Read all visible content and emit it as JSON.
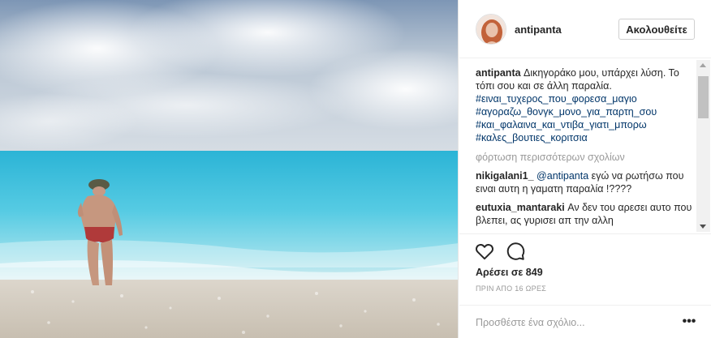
{
  "post": {
    "username": "antipanta",
    "follow_label": "Ακολουθείτε",
    "caption": {
      "username": "antipanta",
      "text": "Δικηγοράκο μου, υπάρχει λύση. Το τόπι σου και σε άλλη παραλία.",
      "hashtags": [
        "#ειναι_τυχερος_που_φορεσα_μαγιο",
        "#αγοραζω_θονγκ_μονο_για_παρτη_σου",
        "#και_φαλαινα_και_ντιβα_γιατι_μπορω",
        "#καλες_βουτιες_κοριτσια"
      ]
    },
    "load_more_label": "φόρτωση περισσότερων σχολίων",
    "comments": [
      {
        "username": "nikigalani1_",
        "mention": "@antipanta",
        "text": "εγώ να ρωτήσω που ειναι αυτη η γαματη παραλία !????"
      },
      {
        "username": "eutuxia_mantaraki",
        "mention": "",
        "text": "Αν δεν του αρεσει αυτο που βλεπει, ας γυρισει απ την αλλη"
      }
    ],
    "likes_label": "Αρέσει σε 849",
    "time_label": "ΠΡΙΝ ΑΠΟ 16 ΩΡΕΣ",
    "comment_placeholder": "Προσθέστε ένα σχόλιο...",
    "more_label": "•••"
  },
  "icons": {
    "like": "heart-icon",
    "comment": "speech-bubble-icon",
    "more": "ellipsis-icon"
  },
  "colors": {
    "link": "#003569",
    "muted": "#999999",
    "sea": "#4fc3dc",
    "sky": "#c9d4df"
  }
}
